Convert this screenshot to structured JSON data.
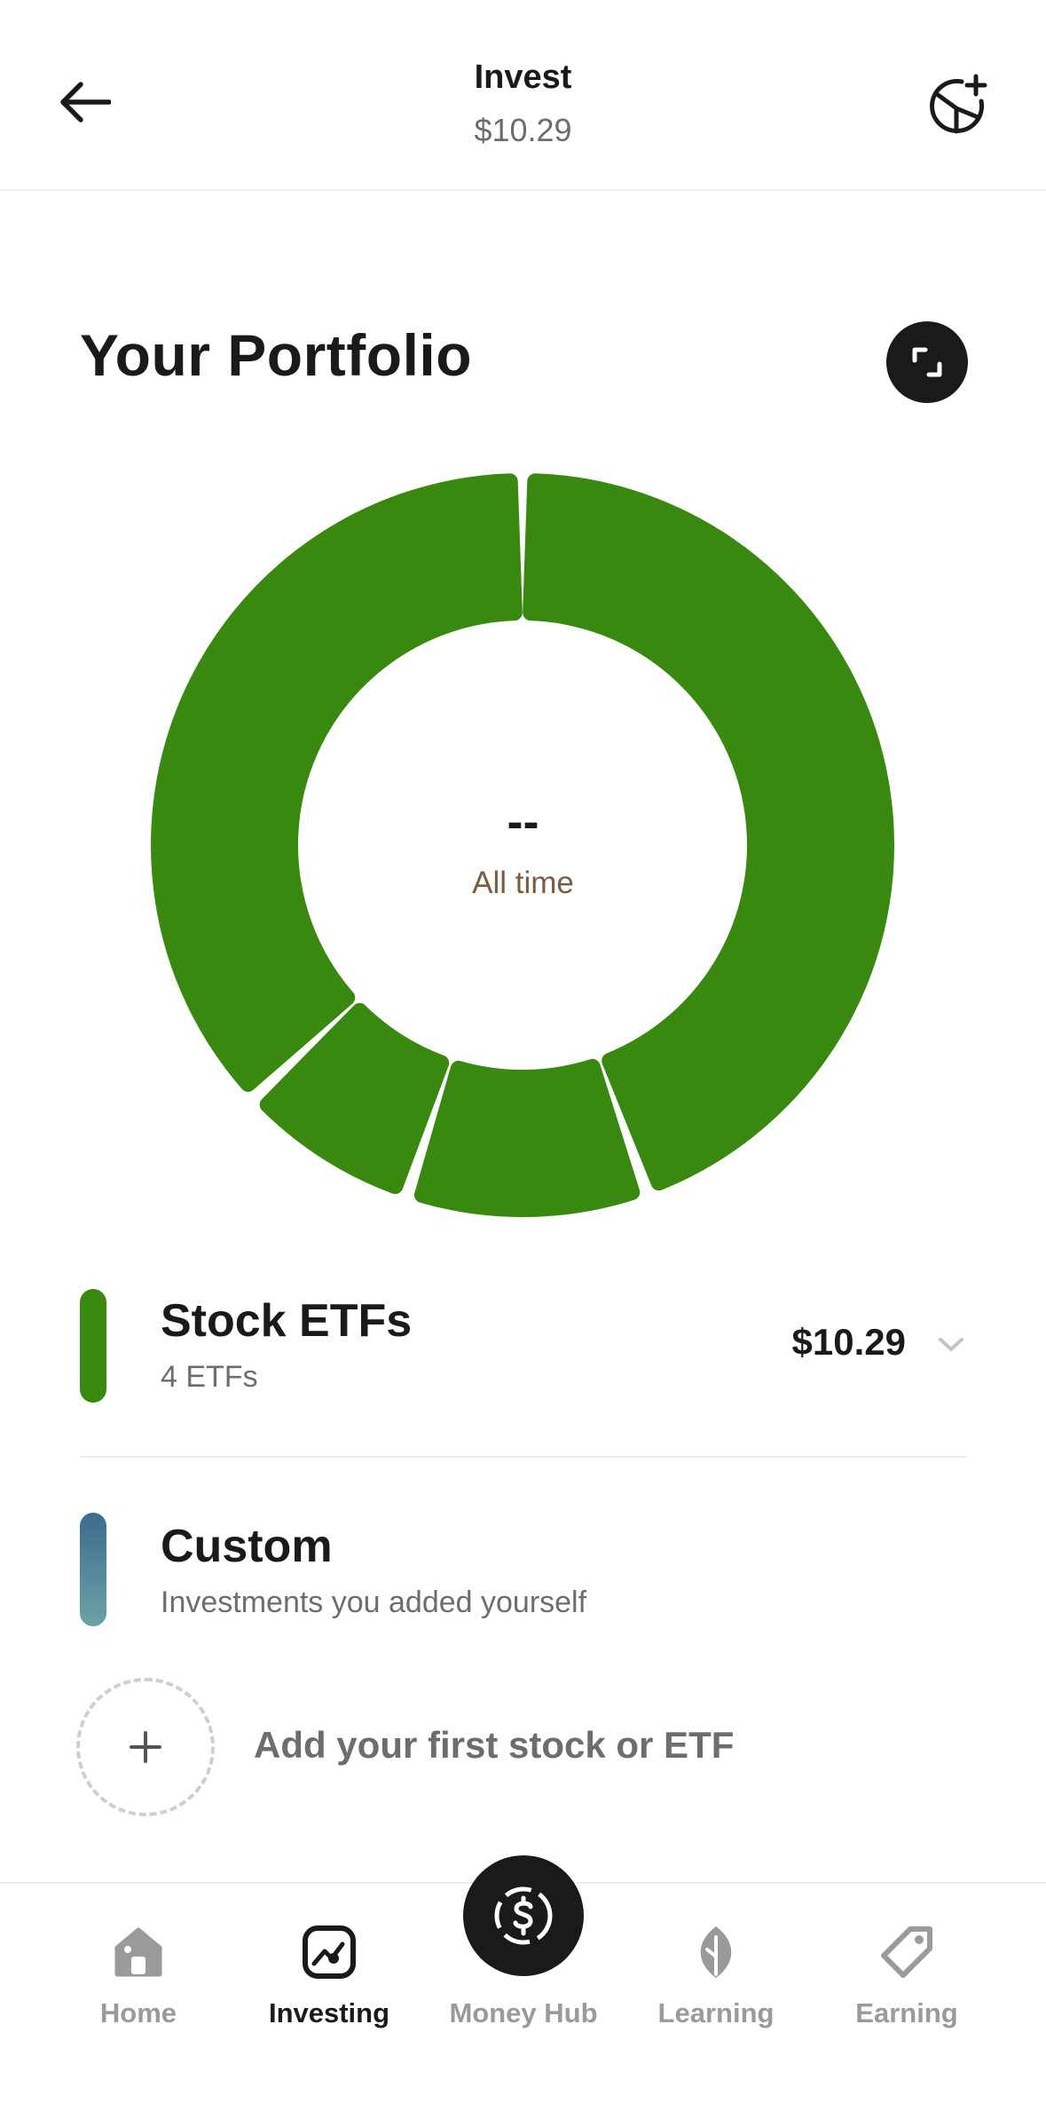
{
  "header": {
    "title": "Invest",
    "balance": "$10.29"
  },
  "portfolio": {
    "title": "Your Portfolio",
    "center_value": "--",
    "center_label": "All time"
  },
  "colors": {
    "stock_etfs": "#398910",
    "custom_top": "#3d6b8d",
    "custom_bottom": "#6aa3a6",
    "dark": "#1a1a1a",
    "muted": "#9a9a9a"
  },
  "categories": [
    {
      "title": "Stock ETFs",
      "subtitle": "4 ETFs",
      "value": "$10.29"
    },
    {
      "title": "Custom",
      "subtitle": "Investments you added yourself"
    }
  ],
  "add_item": {
    "label": "Add your first stock or ETF"
  },
  "tabs": [
    {
      "label": "Home",
      "icon": "home-icon"
    },
    {
      "label": "Investing",
      "icon": "investing-icon"
    },
    {
      "label": "Money Hub",
      "icon": "dollar-icon"
    },
    {
      "label": "Learning",
      "icon": "leaf-icon"
    },
    {
      "label": "Earning",
      "icon": "tag-icon"
    }
  ]
}
